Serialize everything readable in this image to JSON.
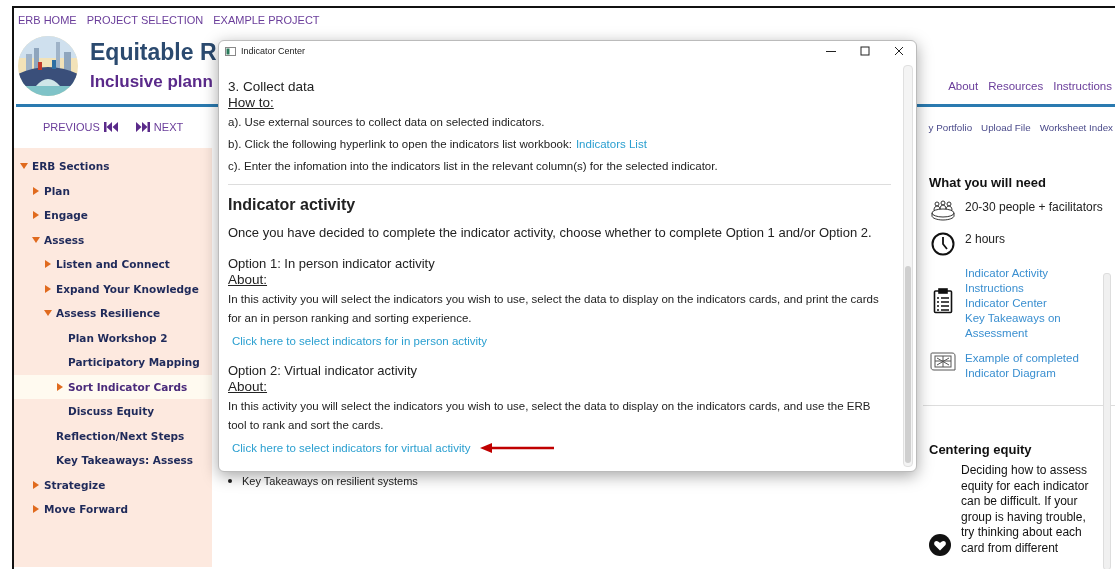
{
  "top_nav": [
    "ERB HOME",
    "PROJECT SELECTION",
    "EXAMPLE PROJECT"
  ],
  "header": {
    "title": "Equitable R",
    "subtitle": "Inclusive plann",
    "links": [
      "About",
      "Resources",
      "Instructions"
    ]
  },
  "pager": {
    "previous": "PREVIOUS",
    "next": "NEXT"
  },
  "toolbar_links": [
    "y Portfolio",
    "Upload File",
    "Worksheet Index"
  ],
  "sidebar": {
    "items": [
      {
        "label": "ERB Sections",
        "kind": "branch",
        "expanded": true,
        "selected": false,
        "children": [
          {
            "label": "Plan",
            "kind": "branch",
            "expanded": false,
            "selected": false
          },
          {
            "label": "Engage",
            "kind": "branch",
            "expanded": false,
            "selected": false
          },
          {
            "label": "Assess",
            "kind": "branch",
            "expanded": true,
            "selected": false,
            "children": [
              {
                "label": "Listen and Connect",
                "kind": "branch",
                "expanded": false,
                "selected": false
              },
              {
                "label": "Expand Your Knowledge",
                "kind": "branch",
                "expanded": false,
                "selected": false
              },
              {
                "label": "Assess Resilience",
                "kind": "branch",
                "expanded": true,
                "selected": false,
                "children": [
                  {
                    "label": "Plan Workshop 2",
                    "kind": "leaf",
                    "selected": false
                  },
                  {
                    "label": "Participatory Mapping",
                    "kind": "leaf",
                    "selected": false
                  },
                  {
                    "label": "Sort Indicator Cards",
                    "kind": "branch",
                    "expanded": false,
                    "selected": true
                  },
                  {
                    "label": "Discuss Equity",
                    "kind": "leaf",
                    "selected": false
                  }
                ]
              },
              {
                "label": "Reflection/Next Steps",
                "kind": "leaf",
                "selected": false
              },
              {
                "label": "Key Takeaways: Assess",
                "kind": "leaf",
                "selected": false
              }
            ]
          },
          {
            "label": "Strategize",
            "kind": "branch",
            "expanded": false,
            "selected": false
          },
          {
            "label": "Move Forward",
            "kind": "branch",
            "expanded": false,
            "selected": false
          }
        ]
      }
    ]
  },
  "background_bullet": "Key Takeaways on resilient systems",
  "needs": {
    "title": "What you will need",
    "items": [
      {
        "kind": "people",
        "text": "20-30 people + facilitators"
      },
      {
        "kind": "duration",
        "text": "2 hours"
      },
      {
        "kind": "resources",
        "links": [
          "Indicator Activity Instructions",
          "Indicator Center",
          "Key Takeaways on Assessment"
        ]
      },
      {
        "kind": "example",
        "links": [
          "Example of completed Indicator Diagram"
        ]
      }
    ]
  },
  "equity": {
    "title": "Centering equity",
    "text": "Deciding how to assess equity for each indicator can be difficult. If your group is having trouble, try thinking about each card from different"
  },
  "dialog": {
    "title": "Indicator Center",
    "step": "3. Collect data",
    "howto": "How to:",
    "steps": [
      {
        "text": "a). Use external sources to collect data on selected indicators."
      },
      {
        "text": "b). Click the following hyperlink to open the indicators list workbook:",
        "link": "Indicators List"
      },
      {
        "text": "c). Enter the infomation into the indicators list in the relevant column(s) for the selected indicator."
      }
    ],
    "heading": "Indicator activity",
    "intro": "Once you have decided to complete the indicator activity, choose whether to complete Option 1 and/or Option 2.",
    "options": [
      {
        "title": "Option 1: In person indicator activity",
        "about": "About:",
        "text": "In this activity you will select the indicators you wish to use, select the data to display on the indicators cards, and print the cards for an in person ranking and sorting experience.",
        "link": "Click here to select indicators for in person activity",
        "pointed": false
      },
      {
        "title": "Option 2: Virtual indicator activity",
        "about": "About:",
        "text": "In this activity you will select the indicators you wish to use, select the data to display on the indicators cards, and use the ERB tool to rank and sort the cards.",
        "link": "Click here to select indicators for virtual activity",
        "pointed": true
      }
    ]
  }
}
